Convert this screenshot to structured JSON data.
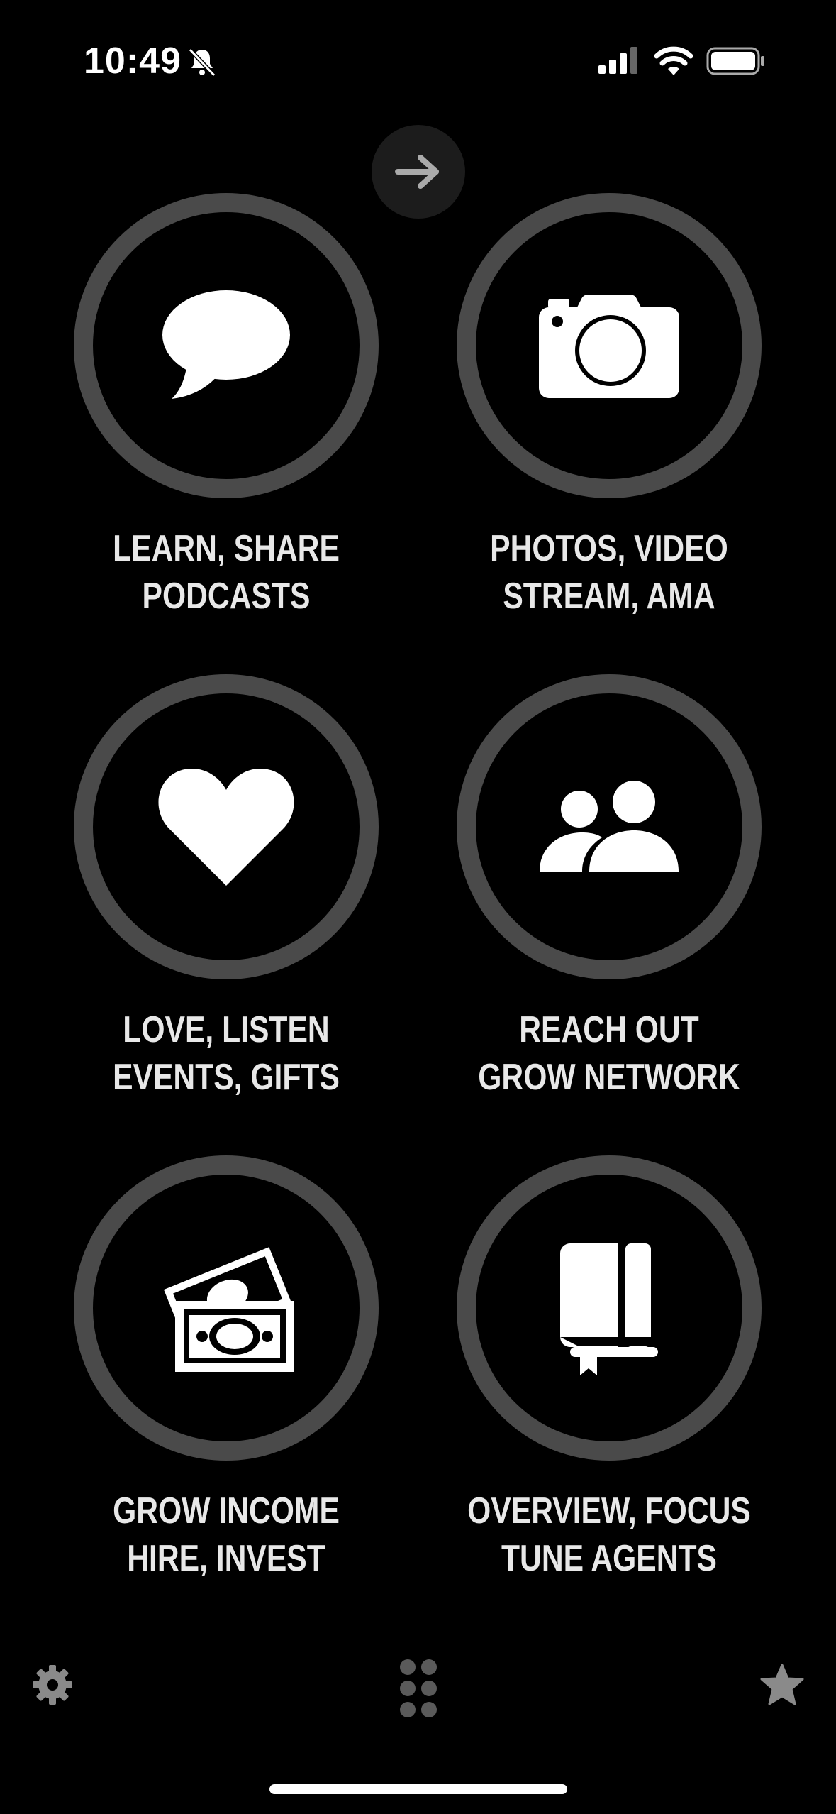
{
  "status_bar": {
    "time": "10:49",
    "icons": [
      "bell-slash-icon",
      "signal-icon",
      "wifi-icon",
      "battery-icon"
    ]
  },
  "next_button": {
    "icon": "arrow-right-icon"
  },
  "tiles": [
    {
      "icon": "speech-bubble-icon",
      "line1": "LEARN, SHARE",
      "line2": "PODCASTS"
    },
    {
      "icon": "camera-icon",
      "line1": "PHOTOS, VIDEO",
      "line2": "STREAM, AMA"
    },
    {
      "icon": "heart-icon",
      "line1": "LOVE, LISTEN",
      "line2": "EVENTS, GIFTS"
    },
    {
      "icon": "people-icon",
      "line1": "REACH OUT",
      "line2": "GROW NETWORK"
    },
    {
      "icon": "money-icon",
      "line1": "GROW INCOME",
      "line2": "HIRE, INVEST"
    },
    {
      "icon": "book-icon",
      "line1": "OVERVIEW, FOCUS",
      "line2": "TUNE AGENTS"
    }
  ],
  "tab_bar": {
    "items": [
      "gear-icon",
      "grid-dots-icon",
      "star-icon"
    ]
  },
  "colors": {
    "background": "#000000",
    "ring": "#4a4a4a",
    "label": "#e8e8e8",
    "button_bg": "#1c1c1c"
  }
}
